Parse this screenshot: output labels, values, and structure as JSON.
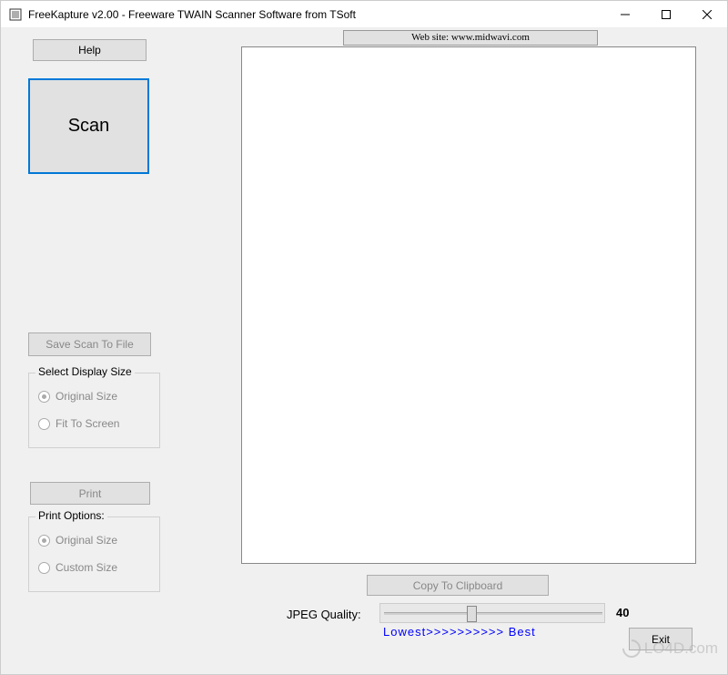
{
  "titlebar": {
    "title": "FreeKapture v2.00 - Freeware TWAIN Scanner Software from TSoft"
  },
  "sidebar": {
    "help_label": "Help",
    "scan_label": "Scan",
    "save_scan_label": "Save Scan To File",
    "display_size": {
      "legend": "Select Display Size",
      "option_original": "Original Size",
      "option_fit": "Fit To Screen"
    },
    "print_label": "Print",
    "print_options": {
      "legend": "Print Options:",
      "option_original": "Original Size",
      "option_custom": "Custom Size"
    }
  },
  "header": {
    "website_text": "Web site: www.midwavi.com"
  },
  "footer": {
    "copy_clipboard_label": "Copy To Clipboard",
    "jpeg_label": "JPEG Quality:",
    "jpeg_value": "40",
    "quality_hint": "Lowest>>>>>>>>>> Best",
    "exit_label": "Exit"
  },
  "watermark": "LO4D.com"
}
